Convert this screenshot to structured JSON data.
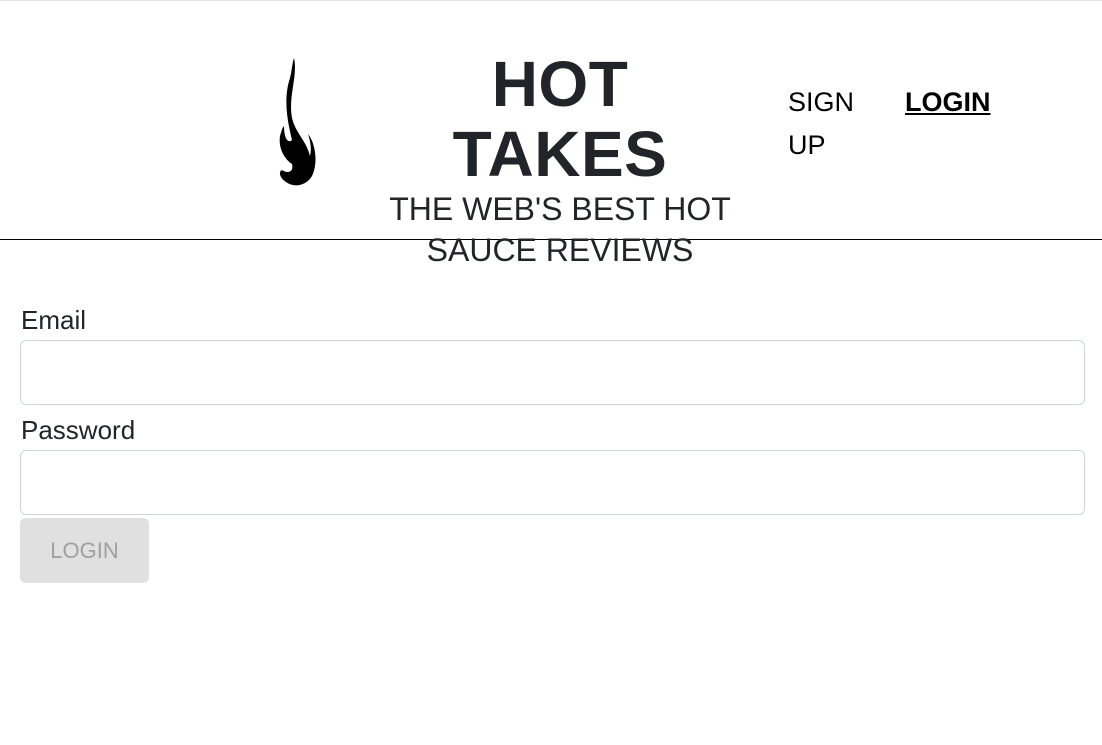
{
  "header": {
    "logo_icon": "flame-icon",
    "title": "HOT TAKES",
    "subtitle": "THE WEB'S BEST HOT SAUCE REVIEWS",
    "nav": {
      "signup": "SIGN UP",
      "login": "LOGIN"
    }
  },
  "form": {
    "email_label": "Email",
    "email_value": "",
    "password_label": "Password",
    "password_value": "",
    "submit_label": "LOGIN"
  }
}
